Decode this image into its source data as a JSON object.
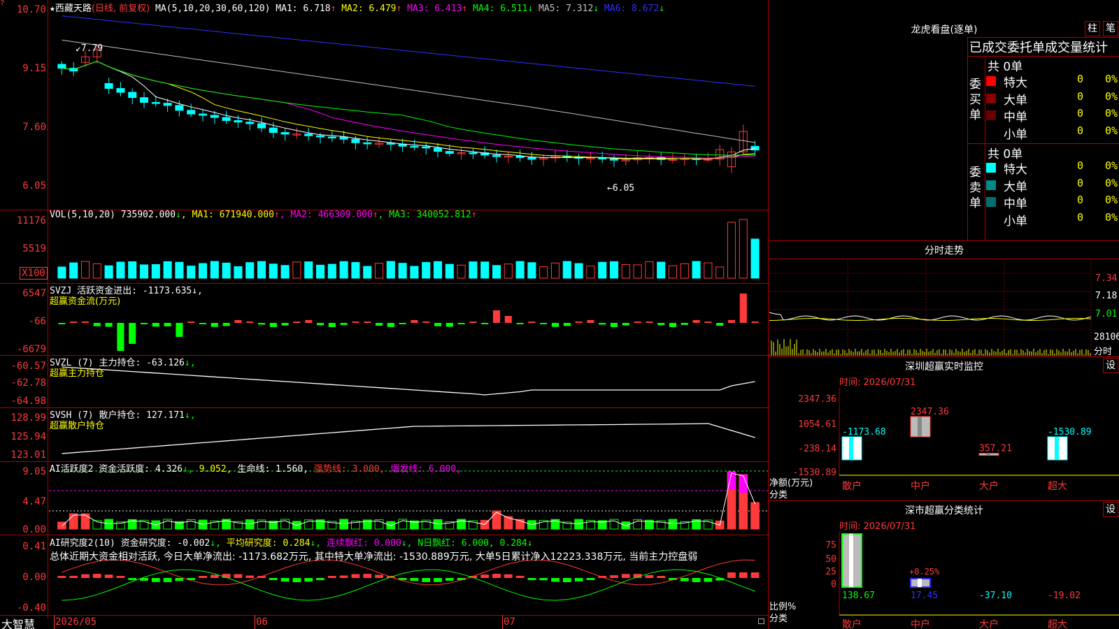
{
  "stock": {
    "star": "★",
    "name": "西藏天路",
    "mode": "(日线, 前复权)",
    "ma_label": "MA(5,10,20,30,60,120)",
    "ma": [
      {
        "label": "MA1:",
        "value": "6.718",
        "arrow": "↑",
        "color": "#ffffff"
      },
      {
        "label": "MA2:",
        "value": "6.479",
        "arrow": "↑",
        "color": "#ffff00"
      },
      {
        "label": "MA3:",
        "value": "6.413",
        "arrow": "↑",
        "color": "#ff00ff"
      },
      {
        "label": "MA4:",
        "value": "6.511",
        "arrow": "↓",
        "color": "#00ff00"
      },
      {
        "label": "MA5:",
        "value": "7.312",
        "arrow": "↓",
        "color": "#c0c0c0"
      },
      {
        "label": "MA6:",
        "value": "8.672",
        "arrow": "↓",
        "color": "#3030ff"
      }
    ],
    "high_mark": "7.79",
    "low_mark": "←6.05",
    "price_axis": [
      "10.70",
      "9.15",
      "7.60",
      "6.05"
    ]
  },
  "vol": {
    "title": "VOL(5,10,20)",
    "value": "735902.000",
    "arrow": "↓",
    "ma": [
      {
        "label": "MA1:",
        "value": "671940.000",
        "arrow": "↑",
        "color": "#ffff00"
      },
      {
        "label": "MA2:",
        "value": "466309.000",
        "arrow": "↑",
        "color": "#ff00ff"
      },
      {
        "label": "MA3:",
        "value": "340052.812",
        "arrow": "↑",
        "color": "#00ff00"
      }
    ],
    "axis": [
      "11176",
      "5519",
      "X100"
    ]
  },
  "svzj": {
    "title": "SVZJ  活跃资金进出: -1173.635",
    "arrow": "↓,",
    "subtitle": "超赢资金流(万元)",
    "axis": [
      "6547",
      "-66",
      "-6679"
    ]
  },
  "svzl": {
    "title": "SVZL (7) 主力持仓: -63.126",
    "arrow": "↓,",
    "subtitle": "超赢主力持仓",
    "axis": [
      "-60.57",
      "-62.78",
      "-64.98"
    ]
  },
  "svsh": {
    "title": "SVSH (7) 散户持仓: 127.171",
    "arrow": "↓,",
    "subtitle": "超赢散户持仓",
    "axis": [
      "128.99",
      "125.94",
      "123.01"
    ]
  },
  "ai_active": {
    "title": "AI活跃度2 资金活跃度: 4.326",
    "v2": "9.052,",
    "v3": "生命线: 1.560,",
    "v4": "强势线: 3.000,",
    "v5": "爆发线: 6.000,",
    "axis": [
      "9.05",
      "4.47",
      "0.00"
    ]
  },
  "ai_research": {
    "title": "AI研究度2(10) 资金研究度: -0.002",
    "p2": "平均研究度: 0.284",
    "p3": "连续飘红: 0.000",
    "p4": "N日飘红: 6.000, 0.284",
    "summary": "总体近期大资金相对活跃, 今日大单净流出: -1173.682万元, 其中特大单净流出: -1530.889万元, 大单5日累计净入12223.338万元, 当前主力控盘弱",
    "axis": [
      "0.41",
      "0.00",
      "-0.40"
    ]
  },
  "bottom": {
    "brand": "大智慧",
    "dates": [
      "2026/05",
      "06",
      "07"
    ]
  },
  "panel_lhb": {
    "title": "龙虎看盘(逐单)",
    "btn1": "柱",
    "btn2": "笔",
    "subtitle": "已成交委托单成交量统计",
    "buy_label": "委买单",
    "sell_label": "委卖单",
    "buy_total": "共 0单",
    "sell_total": "共 0单",
    "buy_rows": [
      {
        "label": "特大",
        "count": "0",
        "pct": "0%",
        "color": "#ff0000"
      },
      {
        "label": "大单",
        "count": "0",
        "pct": "0%",
        "color": "#8b0000"
      },
      {
        "label": "中单",
        "count": "0",
        "pct": "0%",
        "color": "#6b0000"
      },
      {
        "label": "小单",
        "count": "0",
        "pct": "0%",
        "color": "#000000"
      }
    ],
    "sell_rows": [
      {
        "label": "特大",
        "count": "0",
        "pct": "0%",
        "color": "#00ffff"
      },
      {
        "label": "大单",
        "count": "0",
        "pct": "0%",
        "color": "#008b8b"
      },
      {
        "label": "中单",
        "count": "0",
        "pct": "0%",
        "color": "#007070"
      },
      {
        "label": "小单",
        "count": "0",
        "pct": "0%",
        "color": "#000000"
      }
    ]
  },
  "panel_fs": {
    "title": "分时走势",
    "axis": [
      "7.34",
      "7.18",
      "7.01",
      "28106",
      "分时"
    ]
  },
  "panel_monitor": {
    "title": "深圳超赢实时监控",
    "btn": "设",
    "time": "时间: 2026/07/31",
    "axis": [
      "2347.36",
      "1054.61",
      "-238.14",
      "-1530.89"
    ],
    "ylabel": "净额(万元)",
    "xlabel": "分类",
    "bars": [
      {
        "cat": "散户",
        "value": -1173.68,
        "label": "-1173.68",
        "color": "#00ffff"
      },
      {
        "cat": "中户",
        "value": 2347.36,
        "label": "2347.36",
        "color": "#ff3a3a"
      },
      {
        "cat": "大户",
        "value": 357.21,
        "label": "357.21",
        "color": "#ff3a3a"
      },
      {
        "cat": "超大",
        "value": -1530.89,
        "label": "-1530.89",
        "color": "#00ffff"
      }
    ]
  },
  "panel_class": {
    "title": "深市超赢分类统计",
    "btn": "设",
    "time": "时间: 2026/07/31",
    "axis": [
      "75",
      "50",
      "25",
      "0"
    ],
    "ylabel": "比例%",
    "xlabel": "分类",
    "annotation": "+0.25%",
    "bars": [
      {
        "cat": "散户",
        "value": 138.67,
        "label": "138.67",
        "color": "#00ff00"
      },
      {
        "cat": "中户",
        "value": 17.45,
        "label": "17.45",
        "color": "#3030ff"
      },
      {
        "cat": "大户",
        "value": -37.1,
        "label": "-37.10",
        "color": "#00ffff"
      },
      {
        "cat": "超大",
        "value": -19.02,
        "label": "-19.02",
        "color": "#ff3a3a"
      }
    ]
  }
}
